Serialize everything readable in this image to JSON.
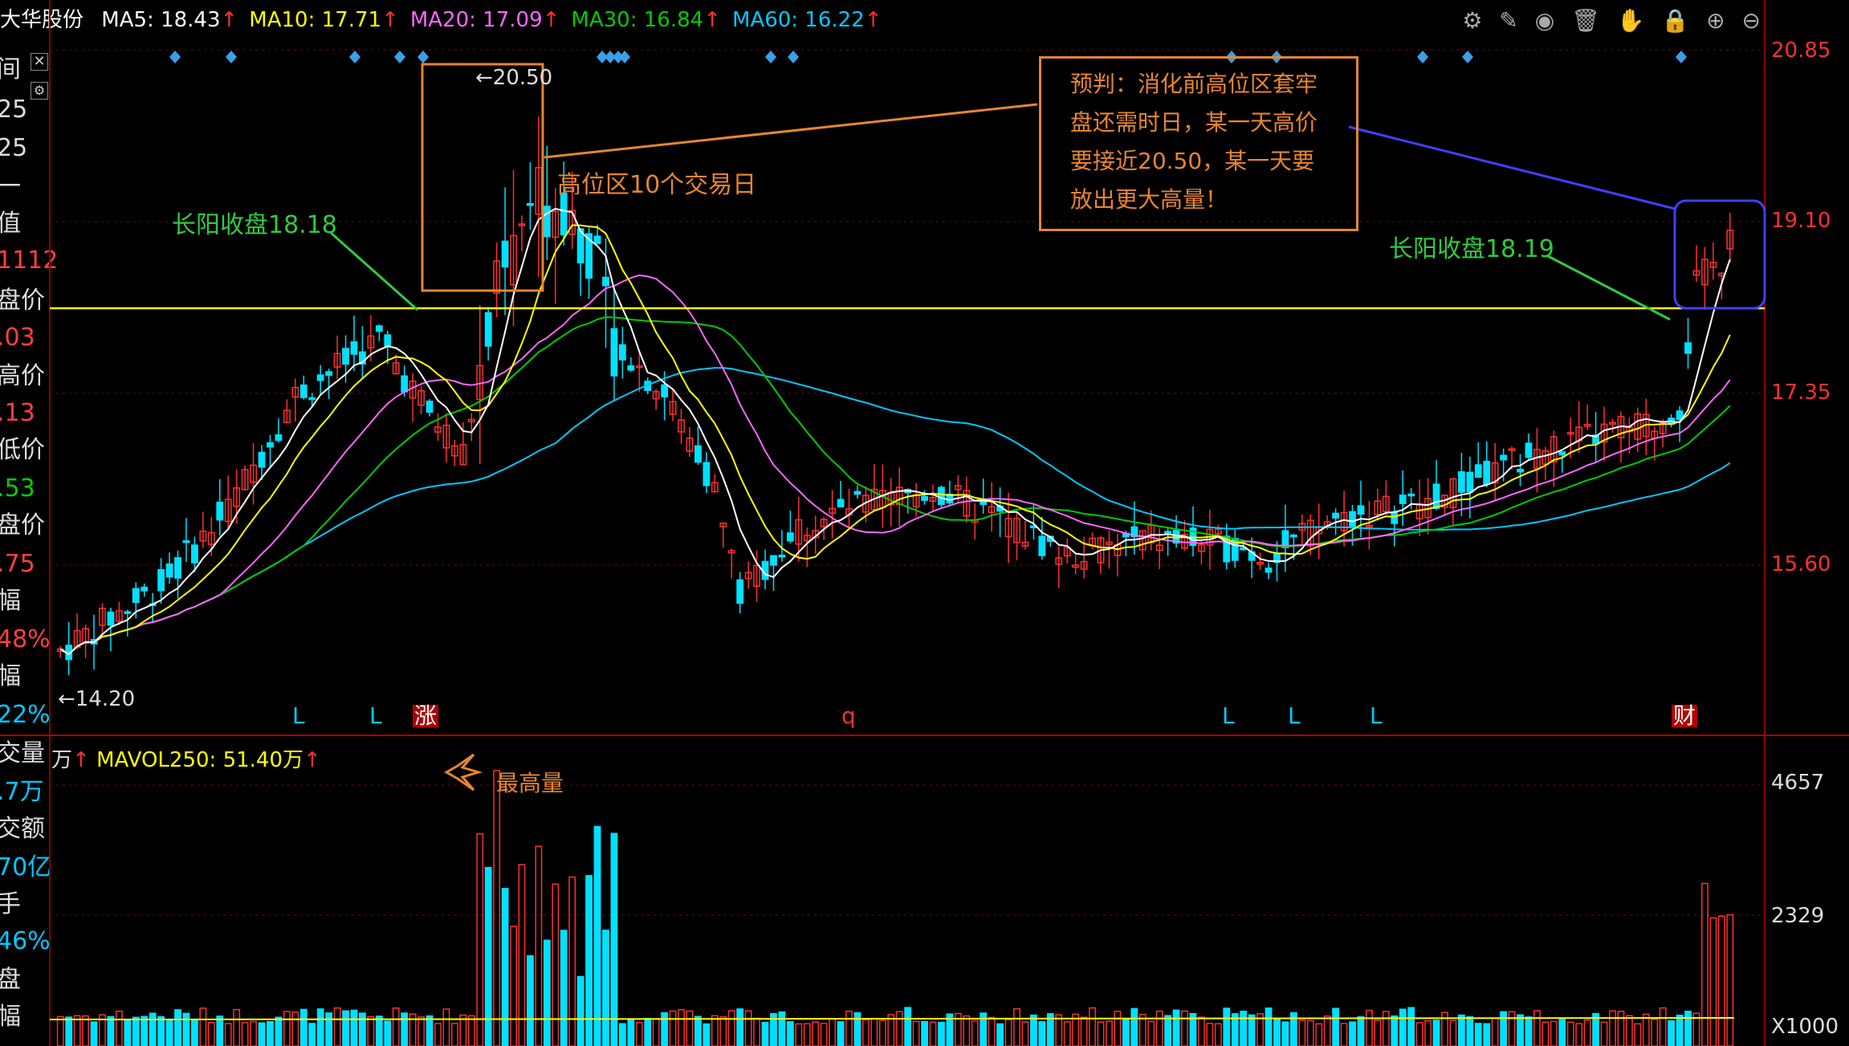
{
  "stock": {
    "name": "大华股份"
  },
  "ma_bar": [
    {
      "label": "MA5: 18.43",
      "color": "#ffffff"
    },
    {
      "label": "MA10: 17.71",
      "color": "#ffff00"
    },
    {
      "label": "MA20: 17.09",
      "color": "#ff66ff"
    },
    {
      "label": "MA30: 16.84",
      "color": "#00cc00"
    },
    {
      "label": "MA60: 16.22",
      "color": "#00c8ff"
    }
  ],
  "left_panel": [
    {
      "text": "间",
      "color": "#ddd"
    },
    {
      "text": "25",
      "color": "#ddd"
    },
    {
      "text": "25",
      "color": "#ddd"
    },
    {
      "text": "一",
      "color": "#ddd"
    },
    {
      "text": "值",
      "color": "#ddd"
    },
    {
      "text": "1112",
      "color": "#ff4040"
    },
    {
      "text": "盘价",
      "color": "#ddd"
    },
    {
      "text": ".03",
      "color": "#ff4040"
    },
    {
      "text": "高价",
      "color": "#ddd"
    },
    {
      "text": ".13",
      "color": "#ff4040"
    },
    {
      "text": "低价",
      "color": "#ddd"
    },
    {
      "text": ".53",
      "color": "#00d000"
    },
    {
      "text": "盘价",
      "color": "#ddd"
    },
    {
      "text": ".75",
      "color": "#ff4040"
    },
    {
      "text": "幅",
      "color": "#ddd"
    },
    {
      "text": "48%",
      "color": "#ff4040"
    },
    {
      "text": "幅",
      "color": "#ddd"
    },
    {
      "text": "22%",
      "color": "#00c8ff"
    }
  ],
  "left_panel_vol": [
    {
      "text": "交量",
      "color": "#ddd"
    },
    {
      "text": ".7万",
      "color": "#00c8ff"
    },
    {
      "text": "交额",
      "color": "#ddd"
    },
    {
      "text": "70亿",
      "color": "#00c8ff"
    },
    {
      "text": "手",
      "color": "#ddd"
    },
    {
      "text": "46%",
      "color": "#00c8ff"
    },
    {
      "text": "盘",
      "color": "#ddd"
    },
    {
      "text": "幅",
      "color": "#ddd"
    }
  ],
  "price_axis": [
    "20.85",
    "19.10",
    "17.35",
    "15.60"
  ],
  "vol_axis": [
    "4657",
    "2329",
    "X1000"
  ],
  "vol_header": {
    "unit": "万",
    "mavol": "MAVOL250: 51.40万"
  },
  "annotations": {
    "high_label": "←20.50",
    "low_label": "←14.20",
    "high_zone": "高位区10个交易日",
    "left_yang": "长阳收盘18.18",
    "right_yang": "长阳收盘18.19",
    "max_volume": "最高量",
    "forecast": [
      "预判：消化前高位区套牢",
      "盘还需时日，某一天高价",
      "要接近20.50，某一天要",
      "放出更大高量！"
    ]
  },
  "markers": [
    {
      "text": "L",
      "color": "#00c8ff"
    },
    {
      "text": "L",
      "color": "#00c8ff"
    },
    {
      "text": "涨",
      "color": "#ffffff",
      "bg": "#b00000"
    },
    {
      "text": "q",
      "color": "#ff3030"
    },
    {
      "text": "L",
      "color": "#00c8ff"
    },
    {
      "text": "L",
      "color": "#00c8ff"
    },
    {
      "text": "L",
      "color": "#00c8ff"
    },
    {
      "text": "财",
      "color": "#ffffff",
      "bg": "#b00000"
    }
  ],
  "toolbar_icons": [
    "gear-icon",
    "pen-icon",
    "eye-icon",
    "trash-icon",
    "hand-icon",
    "lock-icon",
    "zoom-in-icon",
    "zoom-out-icon"
  ],
  "colors": {
    "up": "#ff3030",
    "down": "#00e0ff",
    "ma5": "#ffffff",
    "ma10": "#ffff00",
    "ma20": "#ff66ff",
    "ma30": "#00cc00",
    "ma60": "#00c8ff",
    "grid": "#8b0000",
    "support": "#ffff00",
    "note": "#e8852e",
    "green_note": "#2ecc40",
    "blue_box": "#4040ff"
  }
}
